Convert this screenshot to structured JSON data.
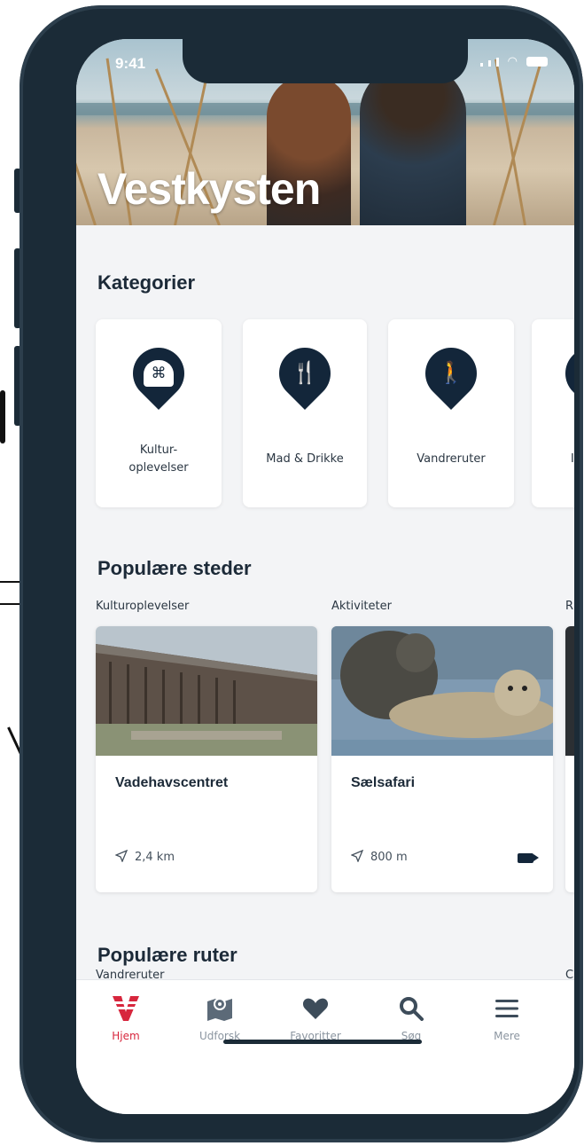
{
  "status_bar": {
    "time": "9:41"
  },
  "hero": {
    "title": "Vestkysten"
  },
  "categories": {
    "title": "Kategorier",
    "items": [
      {
        "label": "Kultur-\noplevelser",
        "icon": "kultur-icon"
      },
      {
        "label": "Mad & Drikke",
        "icon": "fork-knife-icon"
      },
      {
        "label": "Vandreruter",
        "icon": "walking-icon"
      },
      {
        "label": "I",
        "icon": "pin-icon"
      }
    ]
  },
  "popular_places": {
    "title": "Populære steder",
    "columns": [
      {
        "label": "Kulturoplevelser"
      },
      {
        "label": "Aktiviteter"
      },
      {
        "label": "R"
      }
    ],
    "cards": [
      {
        "name": "Vadehavscentret",
        "distance": "2,4 km",
        "has_video": false
      },
      {
        "name": "Sælsafari",
        "distance": "800 m",
        "has_video": true
      }
    ]
  },
  "popular_routes": {
    "title": "Populære ruter",
    "columns": [
      {
        "label": "Vandreruter"
      },
      {
        "label": "C"
      }
    ]
  },
  "tabbar": {
    "items": [
      {
        "label": "Hjem",
        "active": true
      },
      {
        "label": "Udforsk",
        "active": false
      },
      {
        "label": "Favoritter",
        "active": false
      },
      {
        "label": "Søg",
        "active": false
      },
      {
        "label": "Mere",
        "active": false
      }
    ]
  },
  "colors": {
    "accent": "#d7263d",
    "navy": "#13263a",
    "frame": "#1b2b37"
  }
}
